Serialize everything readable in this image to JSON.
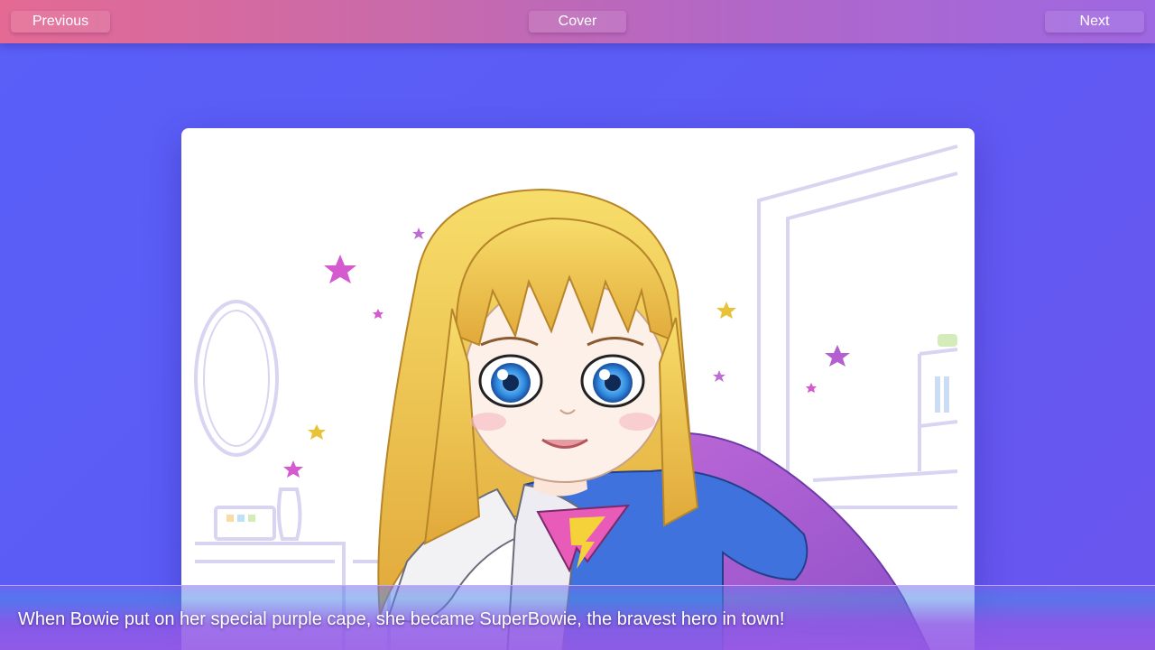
{
  "nav": {
    "previous_label": "Previous",
    "cover_label": "Cover",
    "next_label": "Next"
  },
  "page": {
    "caption": "When Bowie put on her special purple cape, she became SuperBowie, the bravest hero in town!"
  },
  "colors": {
    "topbar_start": "#e46a93",
    "topbar_end": "#9e68e2",
    "background": "#5b5cf6",
    "caption_bar": "#9b5ce6",
    "cape": "#b35fd0",
    "shirt": "#3d6fd8",
    "hair": "#f2cf4a",
    "eyes": "#2f8fe0"
  },
  "icons": {
    "star": "star-icon"
  }
}
